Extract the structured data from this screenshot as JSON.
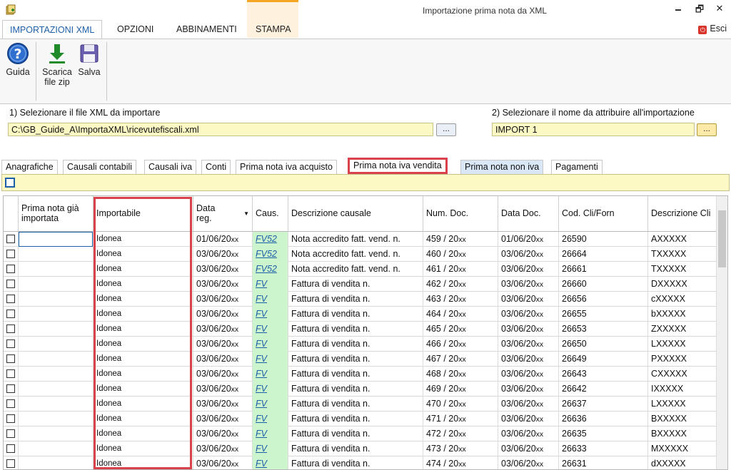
{
  "window": {
    "title": "Importazione prima nota da XML",
    "minimize": "🗕",
    "restore": "🗗",
    "close": "✕"
  },
  "ribbon_tabs": [
    "IMPORTAZIONI XML",
    "OPZIONI",
    "ABBINAMENTI",
    "STAMPA"
  ],
  "esci_label": "Esci",
  "ribbon_buttons": {
    "guida": "Guida",
    "scarica_l1": "Scarica",
    "scarica_l2": "file zip",
    "salva": "Salva"
  },
  "file_section": {
    "step1_label": "1) Selezionare il file XML da importare",
    "step1_value": "C:\\GB_Guide_A\\ImportaXML\\ricevutefiscali.xml",
    "step2_label": "2) Selezionare il nome da attribuire all'importazione",
    "step2_value": "IMPORT 1",
    "browse_label": "..."
  },
  "data_tabs": [
    "Anagrafiche",
    "Causali contabili",
    "Causali iva",
    "Conti",
    "Prima nota iva acquisto",
    "Prima nota iva vendita",
    "Prima nota non iva",
    "Pagamenti"
  ],
  "grid": {
    "headers": {
      "prima_nota": "Prima nota già importata",
      "importabile": "Importabile",
      "data_reg": "Data reg.",
      "caus": "Caus.",
      "descr_causale": "Descrizione causale",
      "num_doc": "Num. Doc.",
      "data_doc": "Data Doc.",
      "cod_cli": "Cod. Cli/Forn",
      "descr_cli": "Descrizione Cli"
    },
    "rows": [
      {
        "imp": "Idonea",
        "data": "01/06/20",
        "caus": "FV52",
        "descr": "Nota accredito fatt. vend. n.",
        "num": "459 / 20",
        "ddoc": "01/06/20",
        "cod": "26590",
        "cli": "AXXXXX"
      },
      {
        "imp": "Idonea",
        "data": "03/06/20",
        "caus": "FV52",
        "descr": "Nota accredito fatt. vend. n.",
        "num": "460 / 20",
        "ddoc": "03/06/20",
        "cod": "26664",
        "cli": "TXXXXX"
      },
      {
        "imp": "Idonea",
        "data": "03/06/20",
        "caus": "FV52",
        "descr": "Nota accredito fatt. vend. n.",
        "num": "461 / 20",
        "ddoc": "03/06/20",
        "cod": "26661",
        "cli": "TXXXXX"
      },
      {
        "imp": "Idonea",
        "data": "03/06/20",
        "caus": "FV",
        "descr": "Fattura di vendita n.",
        "num": "462 / 20",
        "ddoc": "03/06/20",
        "cod": "26660",
        "cli": "DXXXXX"
      },
      {
        "imp": "Idonea",
        "data": "03/06/20",
        "caus": "FV",
        "descr": "Fattura di vendita n.",
        "num": "463 / 20",
        "ddoc": "03/06/20",
        "cod": "26656",
        "cli": "cXXXXX"
      },
      {
        "imp": "Idonea",
        "data": "03/06/20",
        "caus": "FV",
        "descr": "Fattura di vendita n.",
        "num": "464 / 20",
        "ddoc": "03/06/20",
        "cod": "26655",
        "cli": "bXXXXX"
      },
      {
        "imp": "Idonea",
        "data": "03/06/20",
        "caus": "FV",
        "descr": "Fattura di vendita n.",
        "num": "465 / 20",
        "ddoc": "03/06/20",
        "cod": "26653",
        "cli": "ZXXXXX"
      },
      {
        "imp": "Idonea",
        "data": "03/06/20",
        "caus": "FV",
        "descr": "Fattura di vendita n.",
        "num": "466 / 20",
        "ddoc": "03/06/20",
        "cod": "26650",
        "cli": "LXXXXX"
      },
      {
        "imp": "Idonea",
        "data": "03/06/20",
        "caus": "FV",
        "descr": "Fattura di vendita n.",
        "num": "467 / 20",
        "ddoc": "03/06/20",
        "cod": "26649",
        "cli": "PXXXXX"
      },
      {
        "imp": "Idonea",
        "data": "03/06/20",
        "caus": "FV",
        "descr": "Fattura di vendita n.",
        "num": "468 / 20",
        "ddoc": "03/06/20",
        "cod": "26643",
        "cli": "CXXXXX"
      },
      {
        "imp": "Idonea",
        "data": "03/06/20",
        "caus": "FV",
        "descr": "Fattura di vendita n.",
        "num": "469 / 20",
        "ddoc": "03/06/20",
        "cod": "26642",
        "cli": "IXXXXX"
      },
      {
        "imp": "Idonea",
        "data": "03/06/20",
        "caus": "FV",
        "descr": "Fattura di vendita n.",
        "num": "470 / 20",
        "ddoc": "03/06/20",
        "cod": "26637",
        "cli": "LXXXXX"
      },
      {
        "imp": "Idonea",
        "data": "03/06/20",
        "caus": "FV",
        "descr": "Fattura di vendita n.",
        "num": "471 / 20",
        "ddoc": "03/06/20",
        "cod": "26636",
        "cli": "BXXXXX"
      },
      {
        "imp": "Idonea",
        "data": "03/06/20",
        "caus": "FV",
        "descr": "Fattura di vendita n.",
        "num": "472 / 20",
        "ddoc": "03/06/20",
        "cod": "26635",
        "cli": "BXXXXX"
      },
      {
        "imp": "Idonea",
        "data": "03/06/20",
        "caus": "FV",
        "descr": "Fattura di vendita n.",
        "num": "473 / 20",
        "ddoc": "03/06/20",
        "cod": "26633",
        "cli": "MXXXXX"
      },
      {
        "imp": "Idonea",
        "data": "03/06/20",
        "caus": "FV",
        "descr": "Fattura di vendita n.",
        "num": "474 / 20",
        "ddoc": "03/06/20",
        "cod": "26631",
        "cli": "dXXXXX"
      }
    ],
    "year_suffix": "xx"
  }
}
